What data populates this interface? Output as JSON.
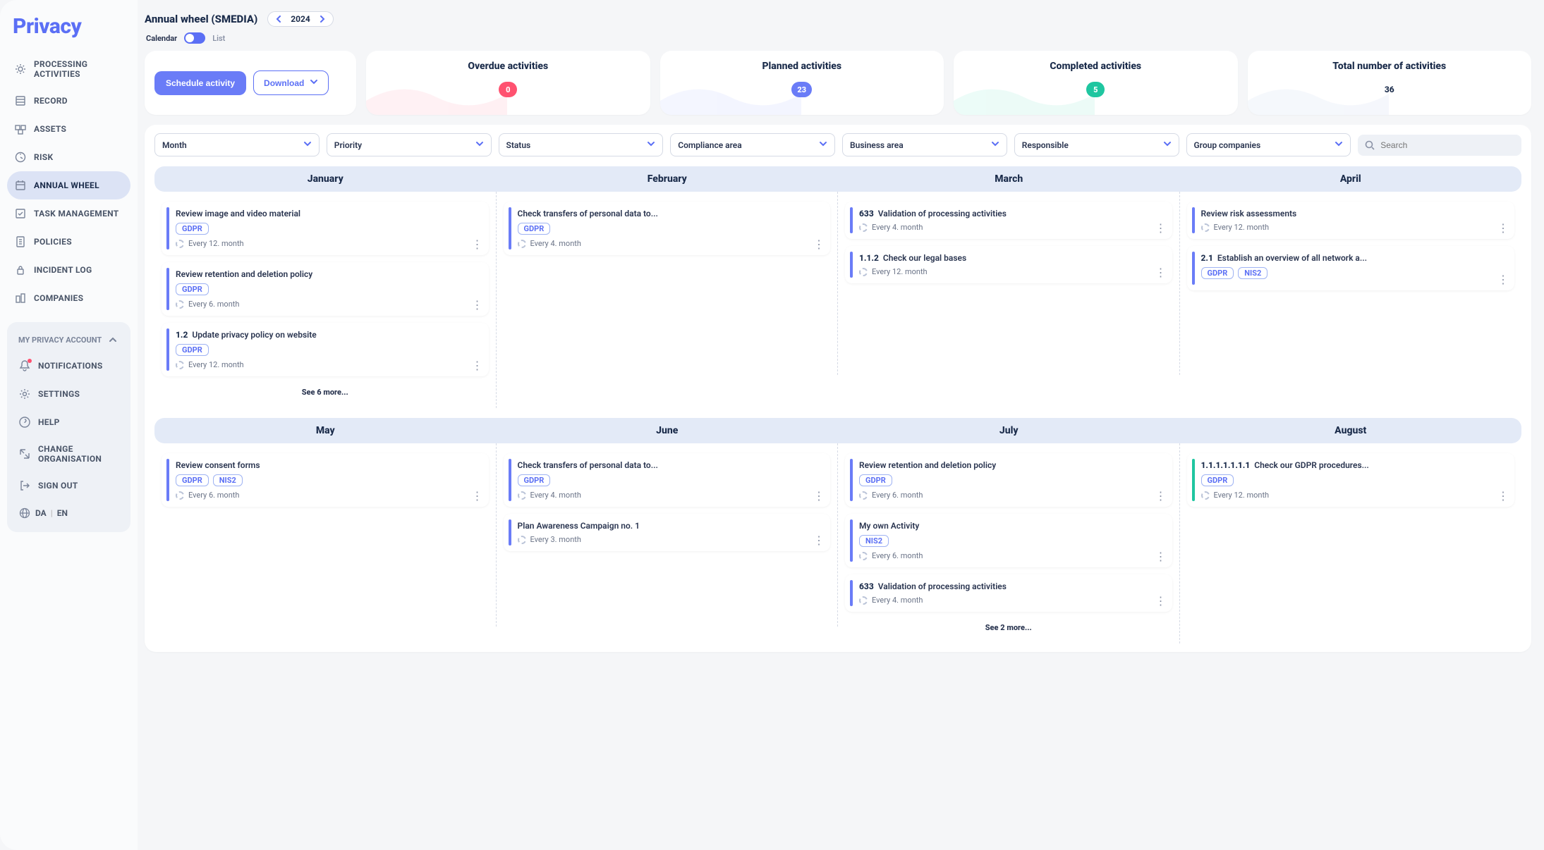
{
  "app": {
    "logo": "Privacy"
  },
  "sidebar": {
    "items": [
      {
        "label": "PROCESSING ACTIVITIES"
      },
      {
        "label": "RECORD"
      },
      {
        "label": "ASSETS"
      },
      {
        "label": "RISK"
      },
      {
        "label": "ANNUAL WHEEL"
      },
      {
        "label": "TASK MANAGEMENT"
      },
      {
        "label": "POLICIES"
      },
      {
        "label": "INCIDENT LOG"
      },
      {
        "label": "COMPANIES"
      }
    ],
    "account_header": "MY PRIVACY ACCOUNT",
    "account_items": [
      {
        "label": "NOTIFICATIONS"
      },
      {
        "label": "SETTINGS"
      },
      {
        "label": "HELP"
      },
      {
        "label": "CHANGE ORGANISATION"
      },
      {
        "label": "SIGN OUT"
      }
    ],
    "lang": {
      "da": "DA",
      "en": "EN"
    }
  },
  "topbar": {
    "title": "Annual wheel (SMEDIA)",
    "year": "2024",
    "calendar_label": "Calendar",
    "list_label": "List"
  },
  "actions": {
    "schedule": "Schedule activity",
    "download": "Download"
  },
  "stats": [
    {
      "title": "Overdue activities",
      "value": "0",
      "color": "#ff5270"
    },
    {
      "title": "Planned activities",
      "value": "23",
      "color": "#6a7cf7"
    },
    {
      "title": "Completed activities",
      "value": "5",
      "color": "#1fc6a0"
    },
    {
      "title": "Total number of activities",
      "value": "36",
      "color": ""
    }
  ],
  "filters": {
    "labels": [
      "Month",
      "Priority",
      "Status",
      "Compliance area",
      "Business area",
      "Responsible",
      "Group companies"
    ],
    "search_placeholder": "Search"
  },
  "colors": {
    "purple": "#6a7cf7",
    "green": "#1fc6a0"
  },
  "months_row1": [
    {
      "name": "January",
      "activities": [
        {
          "code": "",
          "title": "Review image and video material",
          "tags": [
            "GDPR"
          ],
          "recurrence": "Every 12. month",
          "bar": "#6a7cf7"
        },
        {
          "code": "",
          "title": "Review retention and deletion policy",
          "tags": [
            "GDPR"
          ],
          "recurrence": "Every 6. month",
          "bar": "#6a7cf7"
        },
        {
          "code": "1.2",
          "title": "Update privacy policy on website",
          "tags": [
            "GDPR"
          ],
          "recurrence": "Every 12. month",
          "bar": "#6a7cf7"
        }
      ],
      "see_more": "See 6 more..."
    },
    {
      "name": "February",
      "activities": [
        {
          "code": "",
          "title": "Check transfers of personal data to...",
          "tags": [
            "GDPR"
          ],
          "recurrence": "Every 4. month",
          "bar": "#6a7cf7"
        }
      ]
    },
    {
      "name": "March",
      "activities": [
        {
          "code": "633",
          "title": "Validation of processing activities",
          "tags": [],
          "recurrence": "Every 4. month",
          "bar": "#6a7cf7"
        },
        {
          "code": "1.1.2",
          "title": "Check our legal bases",
          "tags": [],
          "recurrence": "Every 12. month",
          "bar": "#6a7cf7"
        }
      ]
    },
    {
      "name": "April",
      "activities": [
        {
          "code": "",
          "title": "Review risk assessments",
          "tags": [],
          "recurrence": "Every 12. month",
          "bar": "#6a7cf7"
        },
        {
          "code": "2.1",
          "title": "Establish an overview of all network a...",
          "tags": [
            "GDPR",
            "NIS2"
          ],
          "recurrence": "",
          "bar": "#6a7cf7"
        }
      ]
    }
  ],
  "months_row2": [
    {
      "name": "May",
      "activities": [
        {
          "code": "",
          "title": "Review consent forms",
          "tags": [
            "GDPR",
            "NIS2"
          ],
          "recurrence": "Every 6. month",
          "bar": "#6a7cf7"
        }
      ]
    },
    {
      "name": "June",
      "activities": [
        {
          "code": "",
          "title": "Check transfers of personal data to...",
          "tags": [
            "GDPR"
          ],
          "recurrence": "Every 4. month",
          "bar": "#6a7cf7"
        },
        {
          "code": "",
          "title": "Plan Awareness Campaign no. 1",
          "tags": [],
          "recurrence": "Every 3. month",
          "bar": "#6a7cf7"
        }
      ]
    },
    {
      "name": "July",
      "activities": [
        {
          "code": "",
          "title": "Review retention and deletion policy",
          "tags": [
            "GDPR"
          ],
          "recurrence": "Every 6. month",
          "bar": "#6a7cf7"
        },
        {
          "code": "",
          "title": "My own Activity",
          "tags": [
            "NIS2"
          ],
          "recurrence": "Every 6. month",
          "bar": "#6a7cf7"
        },
        {
          "code": "633",
          "title": "Validation of processing activities",
          "tags": [],
          "recurrence": "Every 4. month",
          "bar": "#6a7cf7"
        }
      ],
      "see_more": "See 2 more..."
    },
    {
      "name": "August",
      "activities": [
        {
          "code": "1.1.1.1.1.1.1",
          "title": "Check our GDPR procedures...",
          "tags": [
            "GDPR"
          ],
          "recurrence": "Every 12. month",
          "bar": "#1fc6a0"
        }
      ]
    }
  ]
}
